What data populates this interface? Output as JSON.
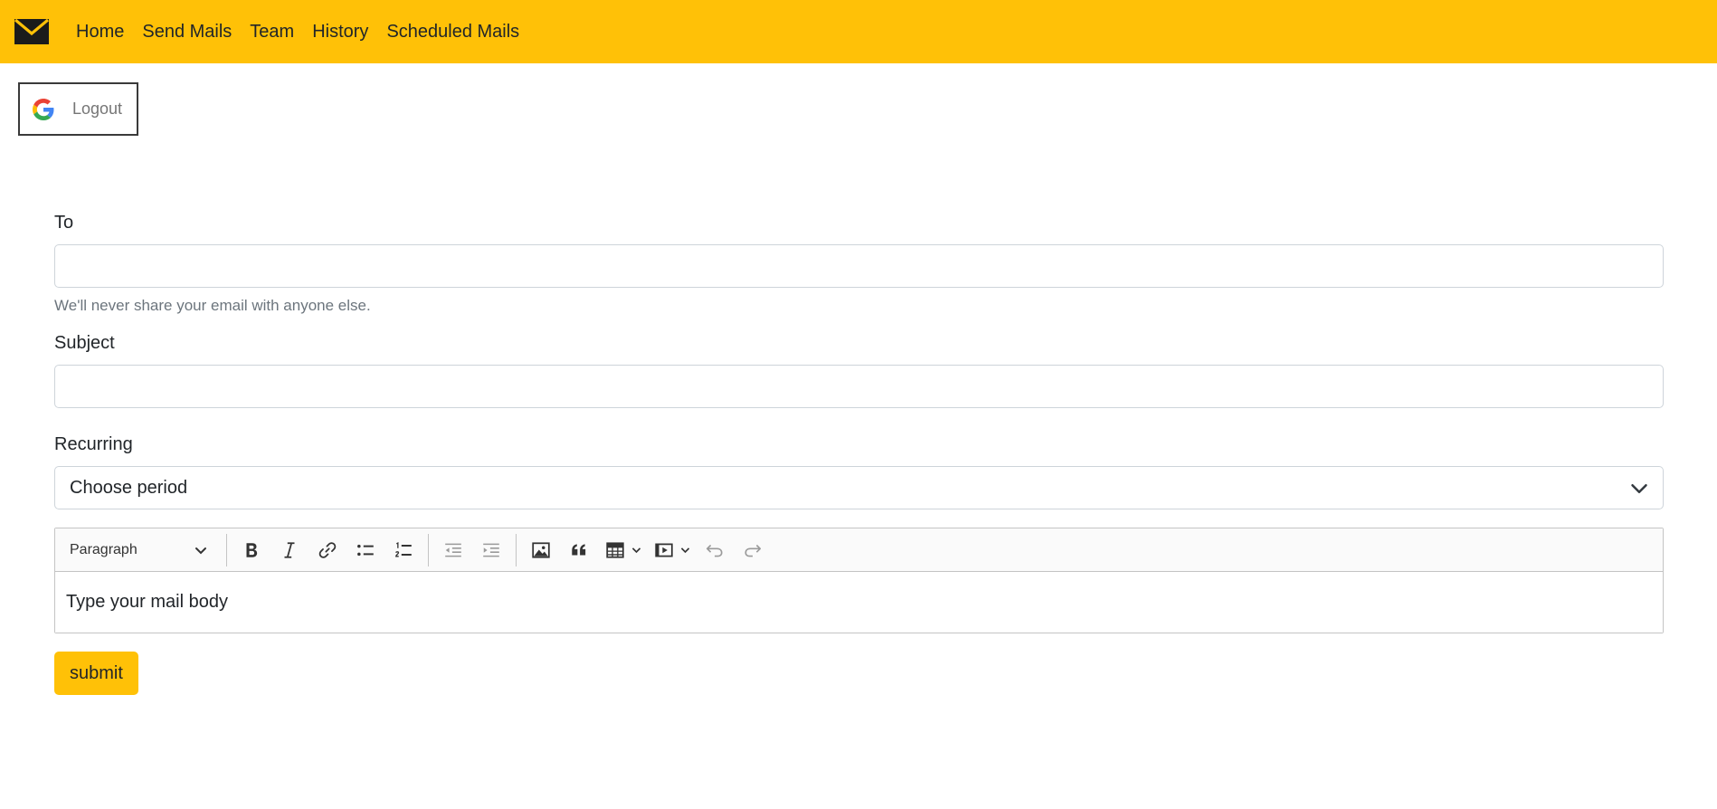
{
  "navbar": {
    "brand_icon": "envelope-icon",
    "links": [
      "Home",
      "Send Mails",
      "Team",
      "History",
      "Scheduled Mails"
    ],
    "background": "#ffc107"
  },
  "auth": {
    "icon": "google-icon",
    "logout_label": "Logout"
  },
  "form": {
    "to": {
      "label": "To",
      "value": "",
      "help_text": "We'll never share your email with anyone else."
    },
    "subject": {
      "label": "Subject",
      "value": ""
    },
    "recurring": {
      "label": "Recurring",
      "selected": "Choose period"
    },
    "editor": {
      "heading_dropdown": "Paragraph",
      "toolbar_buttons": [
        "bold-icon",
        "italic-icon",
        "link-icon",
        "bulleted-list-icon",
        "numbered-list-icon",
        "outdent-icon",
        "indent-icon",
        "image-icon",
        "blockquote-icon",
        "table-icon",
        "media-icon",
        "undo-icon",
        "redo-icon"
      ],
      "body_text": "Type your mail body"
    },
    "submit_label": "submit"
  },
  "colors": {
    "accent": "#ffc107",
    "border": "#ced4da",
    "muted_text": "#6c757d"
  }
}
